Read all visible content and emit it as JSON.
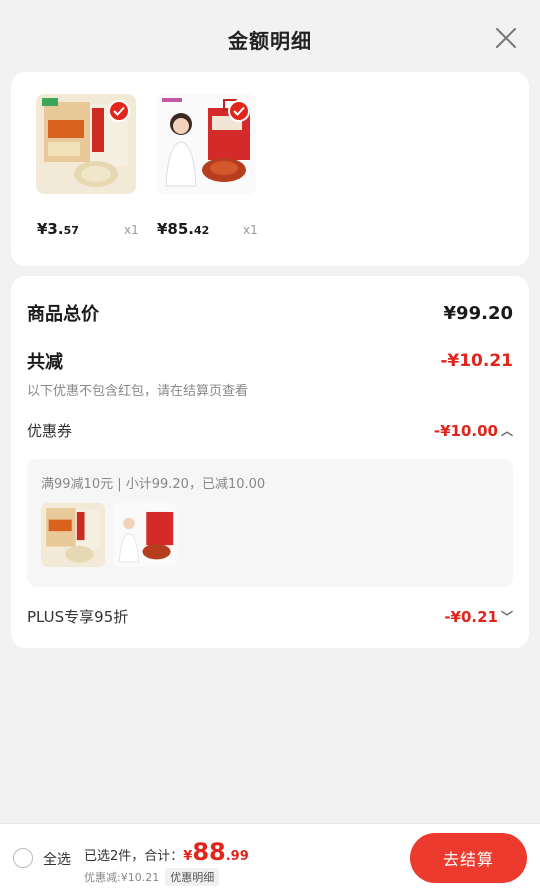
{
  "header": {
    "title": "金额明细"
  },
  "products": [
    {
      "price_main": "¥3.",
      "price_dec": "57",
      "qty": "x1"
    },
    {
      "price_main": "¥85.",
      "price_dec": "42",
      "qty": "x1"
    }
  ],
  "breakdown": {
    "total_label": "商品总价",
    "total_value": "¥99.20",
    "reduce_label": "共减",
    "reduce_value": "-¥10.21",
    "note": "以下优惠不包含红包，请在结算页查看",
    "coupon_label": "优惠券",
    "coupon_value": "-¥10.00",
    "coupon_rule": "满99减10元 | 小计99.20，已减10.00",
    "plus_label": "PLUS专享95折",
    "plus_value": "-¥0.21"
  },
  "footer": {
    "select_all": "全选",
    "selected_prefix": "已选2件，合计：",
    "total_yen": "¥",
    "total_int": "88",
    "total_dec": ".99",
    "discount_text": "优惠减:¥10.21",
    "detail_label": "优惠明细",
    "checkout_label": "去结算"
  },
  "colors": {
    "accent": "#e1251b",
    "button": "#ec3a2e"
  }
}
